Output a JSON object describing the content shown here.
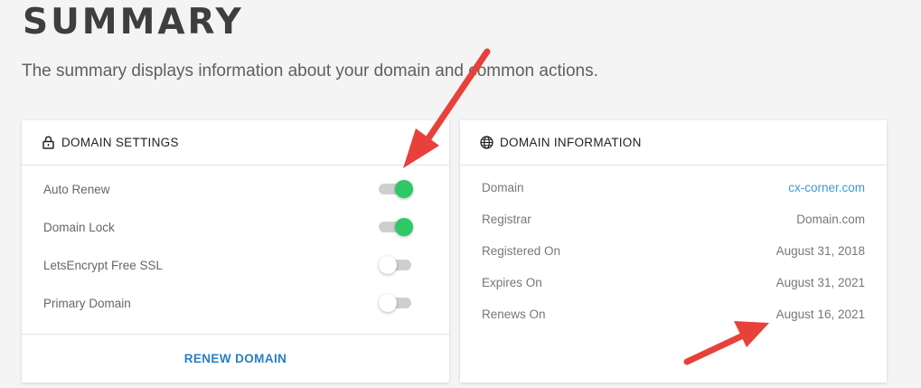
{
  "page": {
    "title": "SUMMARY",
    "description": "The summary displays information about your domain and common actions."
  },
  "domain_settings": {
    "title": "DOMAIN SETTINGS",
    "icon": "lock-icon",
    "rows": [
      {
        "label": "Auto Renew",
        "enabled": true
      },
      {
        "label": "Domain Lock",
        "enabled": true
      },
      {
        "label": "LetsEncrypt Free SSL",
        "enabled": false
      },
      {
        "label": "Primary Domain",
        "enabled": false
      }
    ],
    "renew_label": "RENEW DOMAIN",
    "toggle_on_color": "#2ec866",
    "link_color": "#2a7fc4"
  },
  "domain_information": {
    "title": "DOMAIN INFORMATION",
    "icon": "globe-icon",
    "rows": [
      {
        "label": "Domain",
        "value": "cx-corner.com"
      },
      {
        "label": "Registrar",
        "value": "Domain.com"
      },
      {
        "label": "Registered On",
        "value": "August 31, 2018"
      },
      {
        "label": "Expires On",
        "value": "August 31, 2021"
      },
      {
        "label": "Renews On",
        "value": "August 16, 2021"
      }
    ]
  },
  "annotations": {
    "arrow_color": "#e8403a"
  }
}
